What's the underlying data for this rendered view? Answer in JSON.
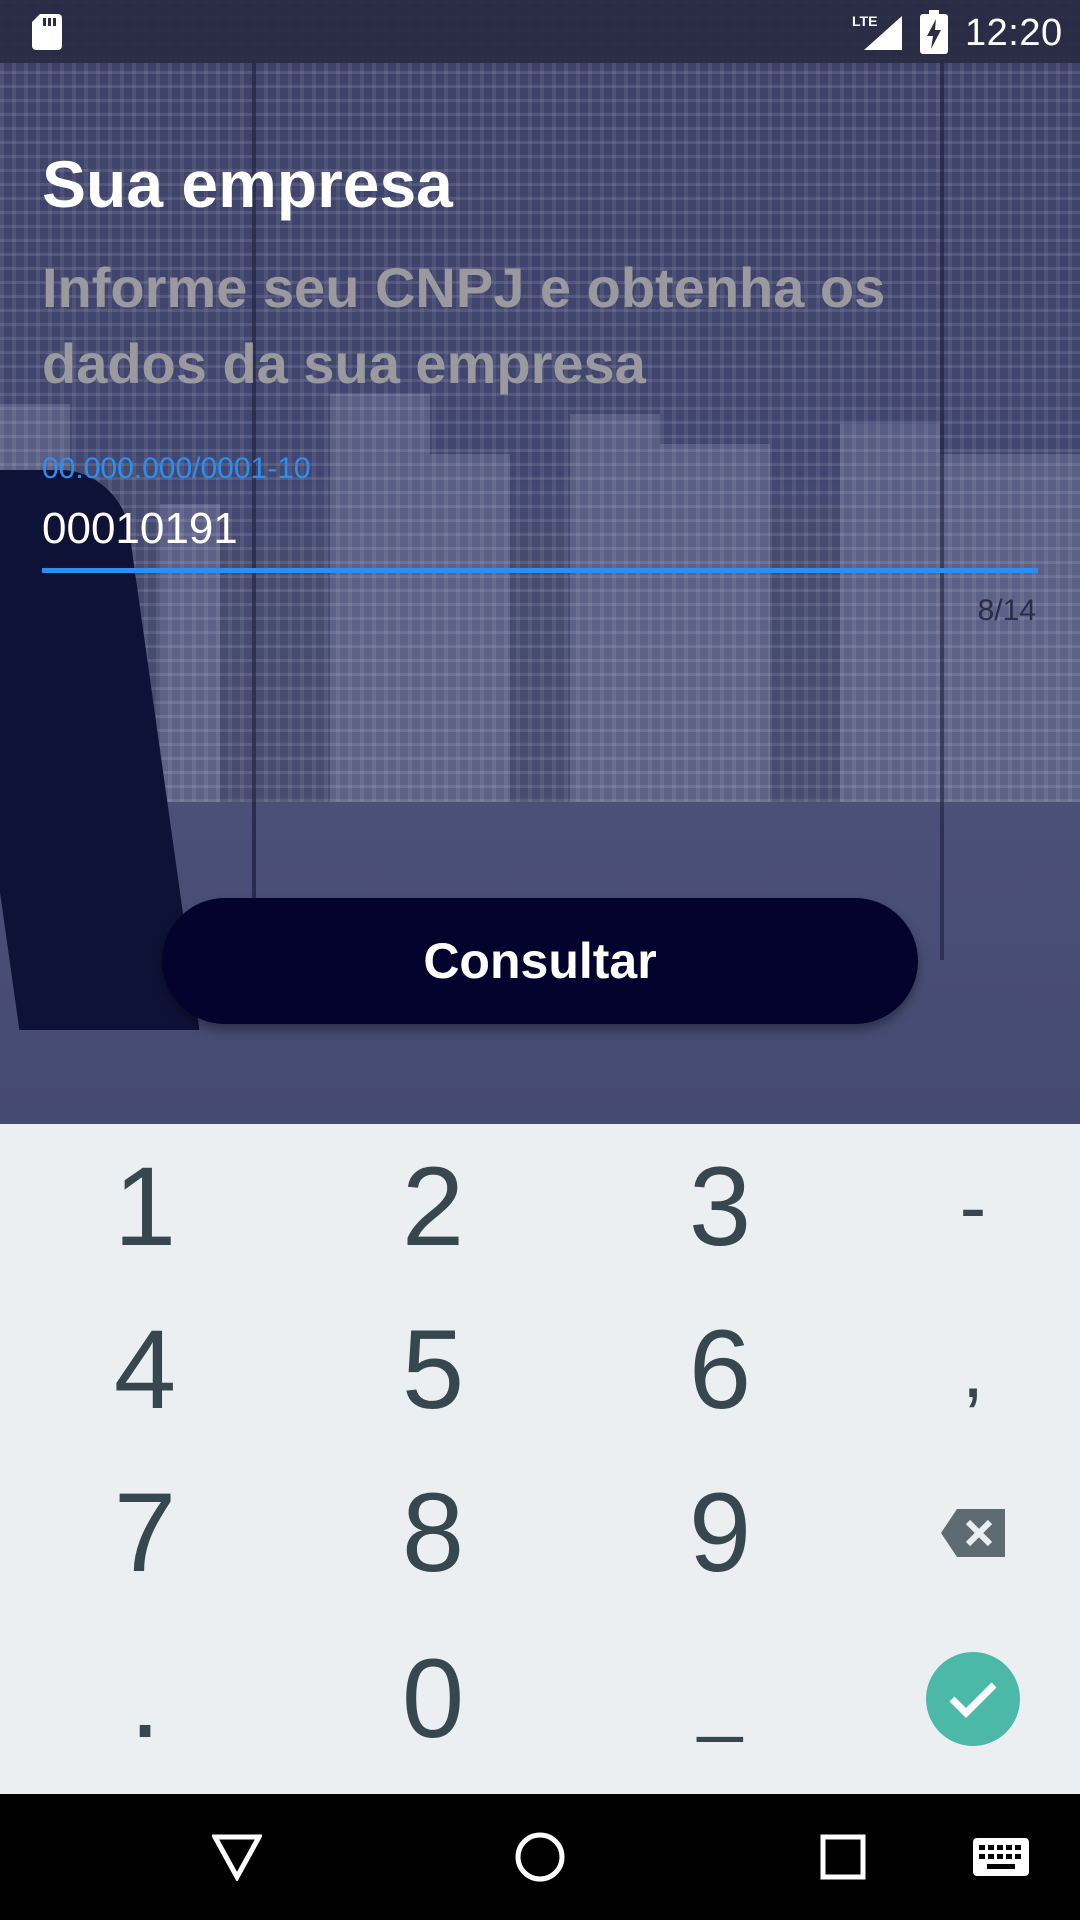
{
  "status_bar": {
    "time": "12:20",
    "network": "LTE",
    "icons": [
      "sd-card-icon",
      "lte-signal-icon",
      "battery-charging-icon"
    ]
  },
  "header": {
    "title": "Sua empresa",
    "subtitle": "Informe seu CNPJ e obtenha os dados da sua empresa"
  },
  "cnpj_field": {
    "hint": "00.000.000/0001-10",
    "value": "00010191",
    "counter": "8/14",
    "accent_color": "#2b8ef0"
  },
  "actions": {
    "consultar_label": "Consultar"
  },
  "keyboard": {
    "row1": [
      "1",
      "2",
      "3",
      "-"
    ],
    "row2": [
      "4",
      "5",
      "6",
      ","
    ],
    "row3": [
      "7",
      "8",
      "9"
    ],
    "row4": [
      ".",
      "0",
      "_"
    ],
    "backspace_icon": "backspace-icon",
    "enter_icon": "check-icon",
    "enter_color": "#4cb8a8"
  },
  "nav_bar": {
    "icons": [
      "back-triangle-icon",
      "home-circle-icon",
      "recents-square-icon",
      "keyboard-icon"
    ]
  }
}
